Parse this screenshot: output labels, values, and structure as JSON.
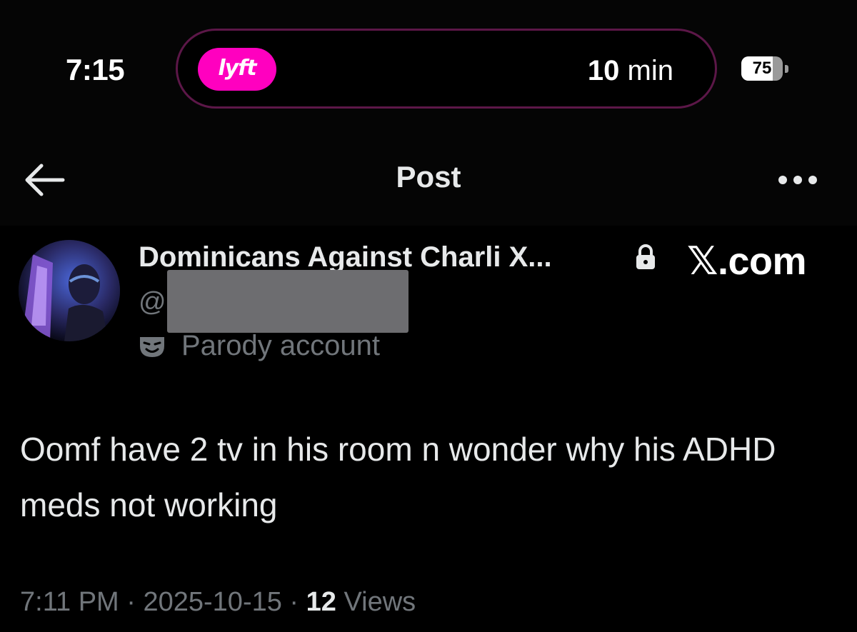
{
  "status_bar": {
    "time": "7:15",
    "live_activity": {
      "app_badge": "lyft",
      "badge_color": "#ff00bf",
      "border_color": "#5c1748",
      "eta_value": "10",
      "eta_unit": "min"
    },
    "battery": {
      "level_text": "75",
      "level_percent": 75
    }
  },
  "nav": {
    "title": "Post",
    "back_icon": "arrow-left-icon",
    "more_icon": "more-horizontal-icon"
  },
  "post": {
    "author": {
      "display_name": "Dominicans Against Charli X...",
      "handle_prefix": "@",
      "protected_icon": "lock-icon",
      "label_icon": "theater-mask-icon",
      "label": "Parody account"
    },
    "watermark": "𝕏.com",
    "text": "Oomf have 2 tv in his room n wonder why his ADHD meds not working",
    "meta": {
      "time": "7:11 PM",
      "separator": " · ",
      "date": "2025-10-15",
      "views_count": "12",
      "views_label": "Views"
    }
  },
  "colors": {
    "background": "#000000",
    "primary_text": "#e7e9ea",
    "secondary_text": "#71767b",
    "redaction": "#6d6d70"
  }
}
